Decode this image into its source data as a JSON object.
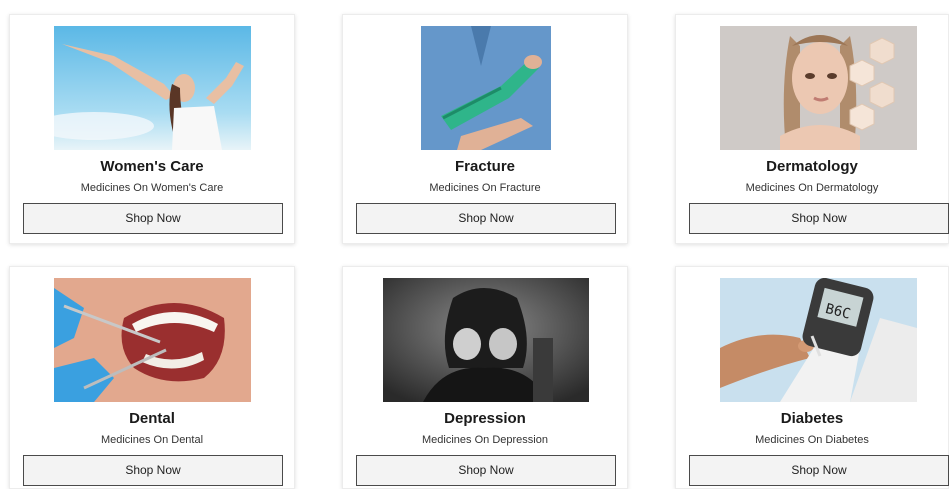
{
  "cards": [
    {
      "title": "Women's Care",
      "subtitle": "Medicines On Women's Care",
      "button": "Shop Now"
    },
    {
      "title": "Fracture",
      "subtitle": "Medicines On Fracture",
      "button": "Shop Now"
    },
    {
      "title": "Dermatology",
      "subtitle": "Medicines On Dermatology",
      "button": "Shop Now"
    },
    {
      "title": "Dental",
      "subtitle": "Medicines On Dental",
      "button": "Shop Now"
    },
    {
      "title": "Depression",
      "subtitle": "Medicines On Depression",
      "button": "Shop Now"
    },
    {
      "title": "Diabetes",
      "subtitle": "Medicines On Diabetes",
      "button": "Shop Now"
    }
  ],
  "colors": {
    "button_bg": "#f3f3f3",
    "button_border": "#4a4a4a",
    "title": "#1a1a1a"
  }
}
